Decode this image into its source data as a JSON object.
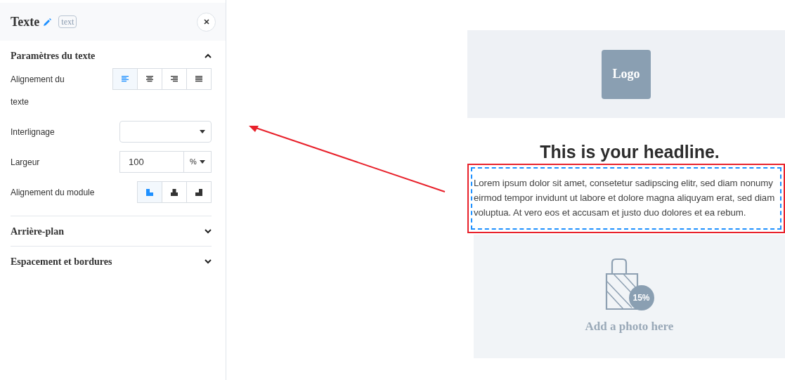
{
  "panel": {
    "title": "Texte",
    "badge": "text",
    "sections": [
      {
        "title": "Paramètres du texte",
        "expanded": true,
        "fields": [
          {
            "kind": "align_group",
            "label": "Alignement du texte",
            "options": [
              {
                "kind": "text_left",
                "selected": true
              },
              {
                "kind": "text_center",
                "selected": false
              },
              {
                "kind": "text_right",
                "selected": false
              },
              {
                "kind": "text_justify",
                "selected": false
              }
            ]
          },
          {
            "kind": "select",
            "label": "Interlignage"
          },
          {
            "kind": "unit_input",
            "label": "Largeur",
            "value": "100",
            "unit": "%"
          },
          {
            "kind": "align_group",
            "label": "Alignement du module",
            "options": [
              {
                "kind": "block_left",
                "selected": true
              },
              {
                "kind": "block_center",
                "selected": false
              },
              {
                "kind": "block_right",
                "selected": false
              }
            ]
          }
        ]
      },
      {
        "title": "Arrière-plan",
        "expanded": false
      },
      {
        "title": "Espacement et bordures",
        "expanded": false
      }
    ]
  },
  "preview": {
    "logo": "Logo",
    "headline": "This is your headline.",
    "paragraph": {
      "text": "Lorem ipsum dolor sit amet, consetetur sadipscing elitr, sed diam nonumy eirmod tempor invidunt ut labore et dolore magna aliquyam erat, sed diam voluptua. At vero eos et accusam et justo duo dolores et ea rebum.",
      "selected": true
    },
    "photo": {
      "badge": "15%",
      "caption": "Add a photo here"
    }
  }
}
